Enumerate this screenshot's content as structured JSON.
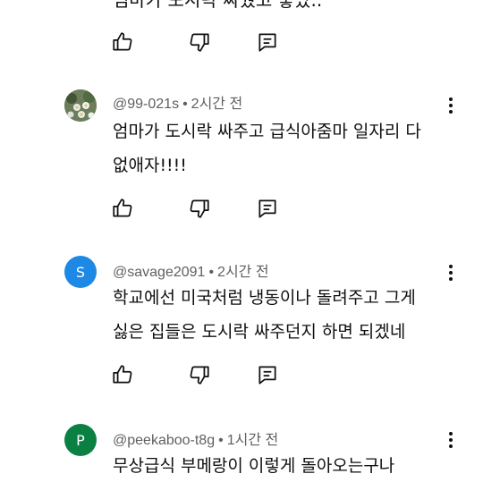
{
  "top_partial": {
    "text": "엄마가 도시락 싸줬고 좋았.."
  },
  "icons": {
    "like": "thumbs-up-icon",
    "dislike": "thumbs-down-icon",
    "reply": "reply-icon",
    "more": "more-vert-icon"
  },
  "comments": [
    {
      "handle": "@99-021s",
      "time": "2시간 전",
      "text_lines": [
        "엄마가 도시락 싸주고 급식아줌마 일자리 다",
        "없애자!!!!"
      ],
      "avatar": {
        "type": "image",
        "letter": ""
      }
    },
    {
      "handle": "@savage2091",
      "time": "2시간 전",
      "text_lines": [
        "학교에선 미국처럼 냉동이나 돌려주고 그게",
        "싫은 집들은 도시락 싸주던지 하면 되겠네"
      ],
      "avatar": {
        "type": "letter",
        "letter": "S",
        "color": "#1e88e5"
      }
    },
    {
      "handle": "@peekaboo-t8g",
      "time": "1시간 전",
      "text_lines": [
        "무상급식 부메랑이 이렇게 돌아오는구나"
      ],
      "avatar": {
        "type": "letter",
        "letter": "P",
        "color": "#0b8043"
      }
    }
  ]
}
